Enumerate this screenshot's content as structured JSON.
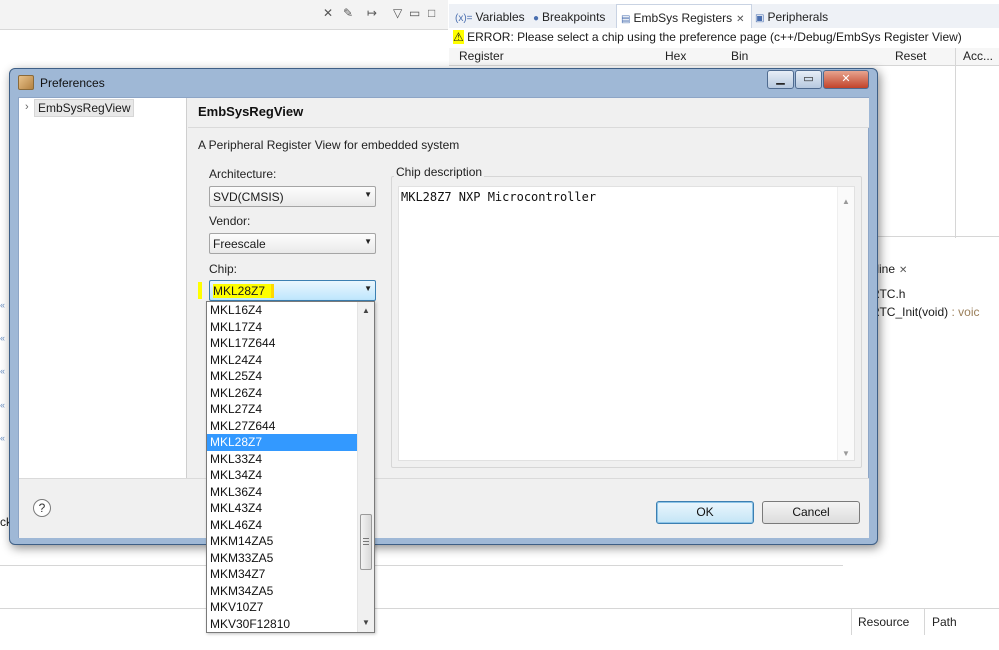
{
  "background": {
    "tabs": [
      {
        "icon": "(x)=",
        "label": "Variables",
        "active": false
      },
      {
        "icon": "●",
        "label": "Breakpoints",
        "active": false
      },
      {
        "icon": "▤",
        "label": "EmbSys Registers",
        "active": true
      },
      {
        "icon": "▣",
        "label": "Peripherals",
        "active": false
      }
    ],
    "error_text": "ERROR: Please select a chip using the preference page (c++/Debug/EmbSys Register View)",
    "register_columns": [
      "Register",
      "Hex",
      "Bin",
      "Reset",
      "Acc..."
    ],
    "outline_tab": "tline",
    "outline_items": [
      {
        "name": "RTC.h",
        "suffix": ""
      },
      {
        "name": "RTC_Init(void)",
        "suffix": " : voic"
      }
    ],
    "left_fragment": "ck",
    "bottom_columns": [
      "Resource",
      "Path"
    ]
  },
  "dialog": {
    "title": "Preferences",
    "tree_item": "EmbSysRegView",
    "page_title": "EmbSysRegView",
    "description": "A Peripheral Register View for embedded system",
    "architecture_label": "Architecture:",
    "architecture_value": "SVD(CMSIS)",
    "vendor_label": "Vendor:",
    "vendor_value": "Freescale",
    "chip_label": "Chip:",
    "chip_value": "MKL28Z7",
    "chip_description_label": "Chip description",
    "chip_description_text": "MKL28Z7 NXP Microcontroller",
    "ok_label": "OK",
    "cancel_label": "Cancel",
    "help_label": "?"
  },
  "chip_list": {
    "selected": "MKL28Z7",
    "items": [
      "MKL16Z4",
      "MKL17Z4",
      "MKL17Z644",
      "MKL24Z4",
      "MKL25Z4",
      "MKL26Z4",
      "MKL27Z4",
      "MKL27Z644",
      "MKL28Z7",
      "MKL33Z4",
      "MKL34Z4",
      "MKL36Z4",
      "MKL43Z4",
      "MKL46Z4",
      "MKM14ZA5",
      "MKM33ZA5",
      "MKM34Z7",
      "MKM34ZA5",
      "MKV10Z7",
      "MKV30F12810"
    ]
  }
}
